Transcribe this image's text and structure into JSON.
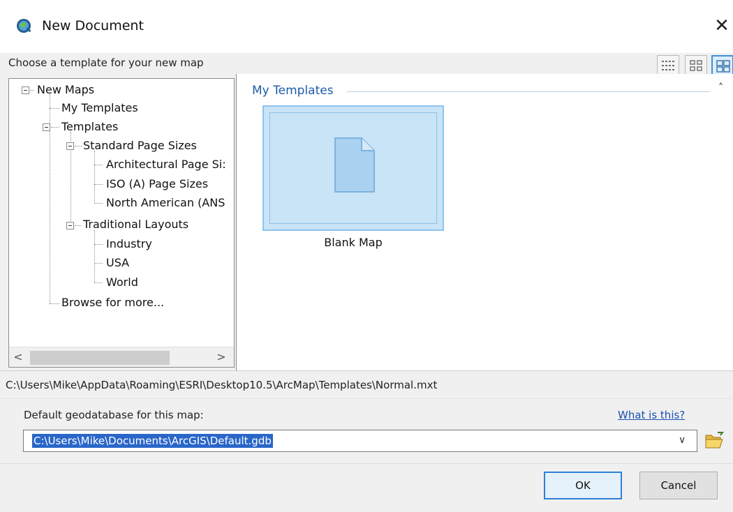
{
  "window": {
    "title": "New Document",
    "close_glyph": "✕",
    "icon": "arcmap-globe-icon"
  },
  "prompt": {
    "text": "Choose a template for your new map",
    "view_buttons": [
      "list-view-icon",
      "small-icons-view-icon",
      "large-icons-view-icon"
    ],
    "active_view": "large-icons-view-icon"
  },
  "tree": {
    "root": "New Maps",
    "my_templates": "My Templates",
    "templates": "Templates",
    "standard_page_sizes": "Standard Page Sizes",
    "architectural": "Architectural Page Si:",
    "iso": "ISO (A) Page Sizes",
    "north_american": "North American (ANS",
    "traditional_layouts": "Traditional Layouts",
    "industry": "Industry",
    "usa": "USA",
    "world": "World",
    "browse": "Browse for more..."
  },
  "scrollbar": {
    "left_arrow": "<",
    "right_arrow": ">"
  },
  "main": {
    "section_title": "My Templates",
    "collapse_glyph": "˄",
    "tiles": [
      {
        "label": "Blank Map",
        "icon": "blank-document-icon"
      }
    ]
  },
  "path": {
    "text": "C:\\Users\\Mike\\AppData\\Roaming\\ESRI\\Desktop10.5\\ArcMap\\Templates\\Normal.mxt"
  },
  "geodatabase": {
    "label": "Default geodatabase for this map:",
    "help_link": "What is this?",
    "value": "C:\\Users\\Mike\\Documents\\ArcGIS\\Default.gdb",
    "dropdown_glyph": "∨",
    "browse_icon": "open-folder-icon"
  },
  "buttons": {
    "ok": "OK",
    "cancel": "Cancel"
  },
  "colors": {
    "accent": "#2f80d6",
    "selection": "#2a66c9",
    "section_header": "#1d5aa6",
    "tile_fill": "#c9e3f7"
  }
}
